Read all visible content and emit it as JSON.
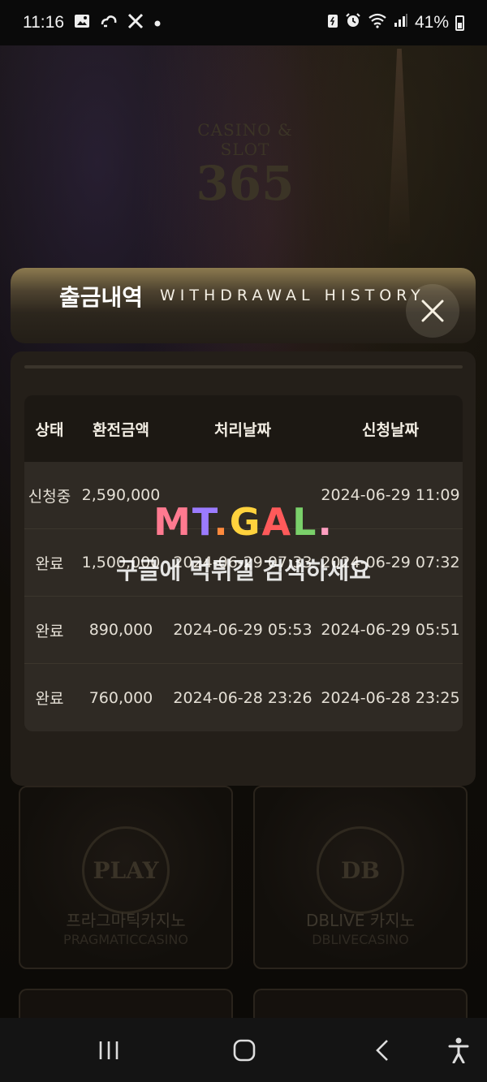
{
  "status_bar": {
    "time": "11:16",
    "left_icons": [
      "image-icon",
      "cloud-sync-icon",
      "x-logo-icon",
      "dot-icon"
    ],
    "right_icons": [
      "battery-saver-icon",
      "alarm-icon",
      "wifi-icon",
      "signal-icon"
    ],
    "battery_percent": "41%"
  },
  "background": {
    "brand_top": "CASINO & SLOT",
    "brand_number": "365",
    "cards": [
      {
        "logo": "PLAY",
        "title": "프라그마틱카지노",
        "subtitle": "PRAGMATICCASINO"
      },
      {
        "logo": "DB",
        "title": "DBLIVE 카지노",
        "subtitle": "DBLIVECASINO"
      }
    ]
  },
  "modal": {
    "title_ko": "출금내역",
    "title_en": "WITHDRAWAL HISTORY",
    "columns": [
      "상태",
      "환전금액",
      "처리날짜",
      "신청날짜"
    ],
    "rows": [
      {
        "status": "신청중",
        "amount": "2,590,000",
        "processed": "",
        "requested": "2024-06-29 11:09"
      },
      {
        "status": "완료",
        "amount": "1,500,000",
        "processed": "2024-06-29 07:33",
        "requested": "2024-06-29 07:32"
      },
      {
        "status": "완료",
        "amount": "890,000",
        "processed": "2024-06-29 05:53",
        "requested": "2024-06-29 05:51"
      },
      {
        "status": "완료",
        "amount": "760,000",
        "processed": "2024-06-28 23:26",
        "requested": "2024-06-28 23:25"
      }
    ]
  },
  "watermark": {
    "logo_chars": [
      "M",
      "T",
      ".",
      "G",
      "A",
      "L",
      "."
    ],
    "text": "구글에 먹튀갤 검색하세요"
  },
  "nav_bar": {
    "buttons": [
      "recent-apps-icon",
      "home-icon",
      "back-icon",
      "accessibility-icon"
    ]
  }
}
